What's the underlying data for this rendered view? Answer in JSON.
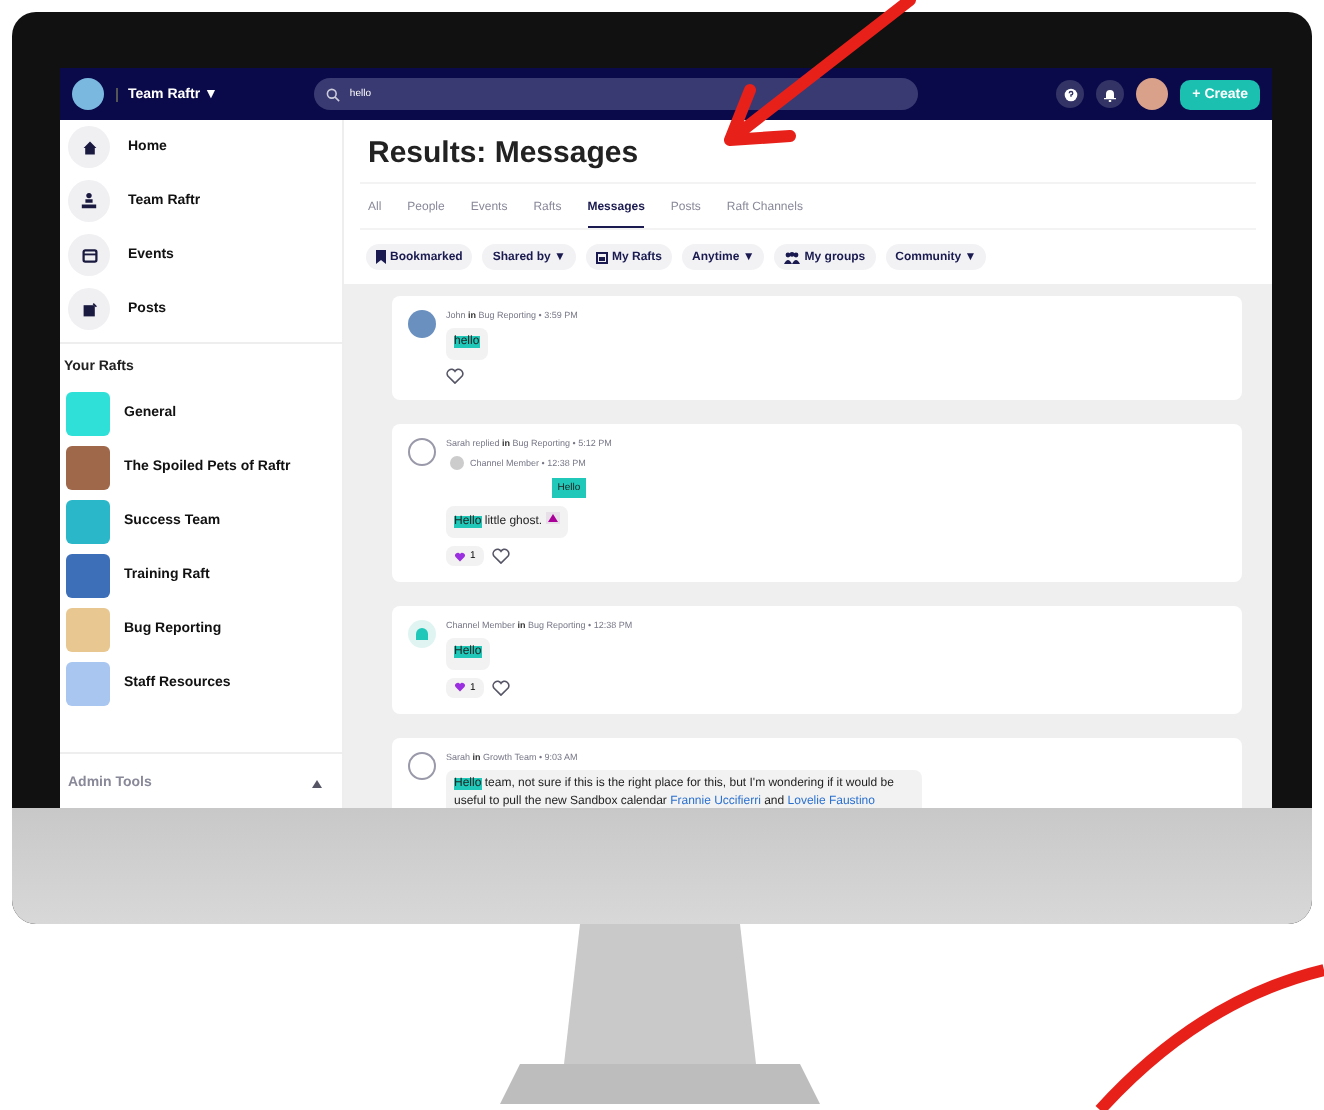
{
  "topbar": {
    "workspace": "Team Raftr ▼",
    "search": {
      "value": "hello"
    },
    "create_button": "+ Create"
  },
  "sidebar": {
    "nav": [
      {
        "label": "Home",
        "kind": "home"
      },
      {
        "label": "Team Raftr",
        "kind": "team"
      },
      {
        "label": "Events",
        "kind": "events"
      },
      {
        "label": "Posts",
        "kind": "posts"
      }
    ],
    "section_title": "Your Rafts",
    "rafts": [
      {
        "label": "General"
      },
      {
        "label": "The Spoiled Pets of Raftr"
      },
      {
        "label": "Success Team"
      },
      {
        "label": "Training Raft"
      },
      {
        "label": "Bug Reporting"
      },
      {
        "label": "Staff Resources"
      }
    ],
    "footer": {
      "label": "Admin Tools",
      "expanded": true
    }
  },
  "main": {
    "title": "Results: Messages",
    "tabs": [
      {
        "label": "All",
        "selected": false
      },
      {
        "label": "People",
        "selected": false
      },
      {
        "label": "Events",
        "selected": false
      },
      {
        "label": "Rafts",
        "selected": false
      },
      {
        "label": "Messages",
        "selected": true
      },
      {
        "label": "Posts",
        "selected": false
      },
      {
        "label": "Raft Channels",
        "selected": false
      }
    ],
    "filters": [
      {
        "label": "Bookmarked",
        "kind": "bookmark"
      },
      {
        "label": "Shared by ▼",
        "kind": "plain"
      },
      {
        "label": "My Rafts",
        "kind": "calendar"
      },
      {
        "label": "Anytime ▼",
        "kind": "plain"
      },
      {
        "label": "My groups",
        "kind": "group"
      },
      {
        "label": "Community ▼",
        "kind": "plain"
      }
    ],
    "messages": [
      {
        "avatar": {
          "kind": "photo"
        },
        "header": "John **in** Bug Reporting • 3:59 PM",
        "body": [
          {
            "kind": "highlight",
            "text": "hello"
          }
        ]
      },
      {
        "avatar": {
          "kind": "emblem"
        },
        "header": "Sarah replied **in** Bug Reporting • 5:12 PM",
        "quote": {
          "header": "Channel Member • 12:38 PM",
          "text": "Hello"
        },
        "body": [
          {
            "kind": "highlight",
            "text": "Hello"
          },
          {
            "kind": "text",
            "text": " little ghost."
          },
          {
            "kind": "sticker"
          }
        ],
        "reaction": {
          "count": "1"
        }
      },
      {
        "avatar": {
          "kind": "ghost"
        },
        "header": "Channel Member **in** Bug Reporting • 12:38 PM",
        "body": [
          {
            "kind": "highlight",
            "text": "Hello"
          }
        ],
        "reaction": {
          "count": "1"
        }
      },
      {
        "avatar": {
          "kind": "emblem"
        },
        "header": "Sarah **in** Growth Team • 9:03 AM",
        "body": [
          {
            "kind": "highlight",
            "text": "Hello"
          },
          {
            "kind": "text",
            "text": " team, not sure if this is the right place for this, but I'm wondering if it would be useful to pull the new Sandbox calendar "
          },
          {
            "kind": "mention",
            "text": "Frannie Uccifierri"
          },
          {
            "kind": "text",
            "text": " and "
          },
          {
            "kind": "mention",
            "text": "Lovelie Faustino"
          }
        ]
      }
    ]
  }
}
